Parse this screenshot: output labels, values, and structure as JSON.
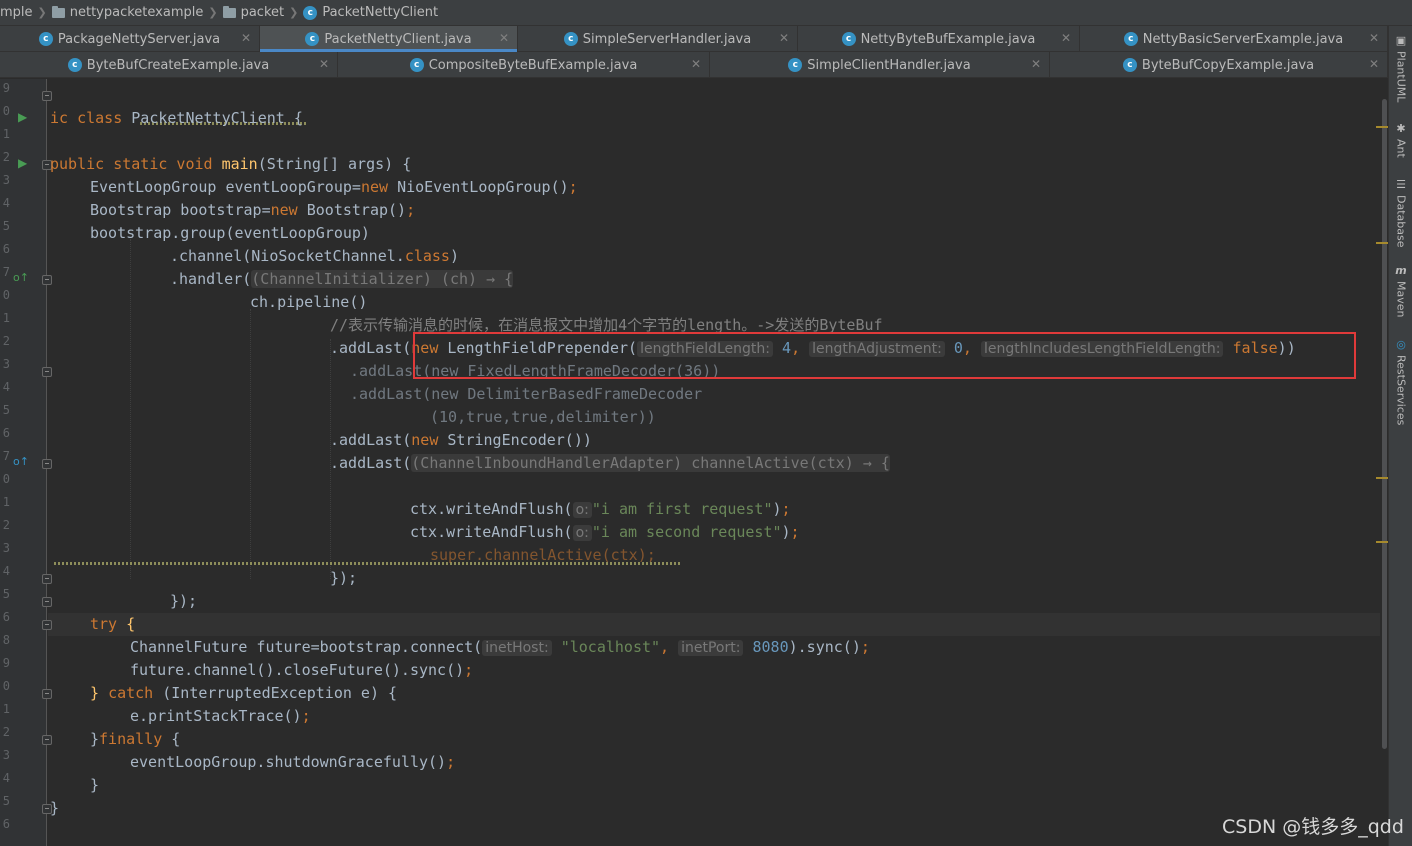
{
  "breadcrumb": {
    "items": [
      "mple",
      "nettypacketexample",
      "packet",
      "PacketNettyClient"
    ]
  },
  "tabs_row1": [
    {
      "label": "PackageNettyServer.java",
      "active": false
    },
    {
      "label": "PacketNettyClient.java",
      "active": true
    },
    {
      "label": "SimpleServerHandler.java",
      "active": false
    },
    {
      "label": "NettyByteBufExample.java",
      "active": false
    },
    {
      "label": "NettyBasicServerExample.java",
      "active": false
    }
  ],
  "tabs_row2": [
    {
      "label": "ByteBufCreateExample.java"
    },
    {
      "label": "CompositeByteBufExample.java"
    },
    {
      "label": "SimpleClientHandler.java"
    },
    {
      "label": "ByteBufCopyExample.java"
    }
  ],
  "gutter_numbers": [
    "9",
    "0",
    "1",
    "2",
    "3",
    "4",
    "5",
    "6",
    "7",
    "0",
    "1",
    "2",
    "3",
    "4",
    "5",
    "6",
    "7",
    "0",
    "1",
    "2",
    "3",
    "4",
    "5",
    "6",
    "8",
    "9",
    "0",
    "1",
    "2",
    "3",
    "4",
    "5",
    "6"
  ],
  "code": {
    "l1a": "ic ",
    "l1b": "class ",
    "l1c": "PacketNettyClient ",
    "l1d": "{",
    "l3a": "public static void ",
    "l3b": "main",
    "l3c": "(String[] args) {",
    "l4a": "EventLoopGroup eventLoopGroup=",
    "l4b": "new ",
    "l4c": "NioEventLoopGroup()",
    "l4d": ";",
    "l5a": "Bootstrap bootstrap=",
    "l5b": "new ",
    "l5c": "Bootstrap()",
    "l5d": ";",
    "l6": "bootstrap.group(eventLoopGroup)",
    "l7a": ".channel(NioSocketChannel.",
    "l7b": "class",
    ")": ")",
    "l8a": ".handler(",
    "l8b": "(ChannelInitializer) (ch) → {",
    "l9": "ch.pipeline()",
    "l10": "//表示传输消息的时候，在消息报文中增加4个字节的length。->发送的ByteBuf",
    "l11a": ".addLast(",
    "l11b": "new ",
    "l11c": "LengthFieldPrepender(",
    "hint_lfl": "lengthFieldLength:",
    "v_lfl": "4",
    "hint_la": "lengthAdjustment:",
    "v_la": "0",
    "hint_lil": "lengthIncludesLengthFieldLength:",
    "v_lil": "false",
    "l11end": "))",
    "l12": ".addLast(new FixedLengthFrameDecoder(36))",
    "l13": ".addLast(new DelimiterBasedFrameDecoder",
    "l14": "(10,true,true,delimiter))",
    "l15a": ".addLast(",
    "l15b": "new ",
    "l15c": "StringEncoder())",
    "l16a": ".addLast(",
    "l16b": "(ChannelInboundHandlerAdapter) channelActive(ctx) → {",
    "l18a": "ctx.writeAndFlush(",
    "hint_o": "o:",
    "l18b": "\"i am first request\"",
    "l18c": ")",
    ";": ";",
    "l19b": "\"i am second request\"",
    "l20": "super.channelActive(ctx);",
    "l21": "});",
    "l22": "});",
    "l23a": "try ",
    "l23b": "{",
    "l24a": "ChannelFuture future=bootstrap.connect(",
    "hint_host": "inetHost:",
    "v_host": "\"localhost\"",
    "comma": ", ",
    "hint_port": "inetPort:",
    "v_port": "8080",
    "l24b": ").sync()",
    "l25a": "future.channel().closeFuture().sync()",
    "l26a": "} ",
    "l26b": "catch ",
    "l26c": "(InterruptedException e) {",
    "l27": "e.printStackTrace()",
    "l28a": "}",
    "l28b": "finally ",
    "l28c": "{",
    "l29": "eventLoopGroup.shutdownGracefully()",
    "l30": "}",
    "l31": "}"
  },
  "right_panels": [
    "PlantUML",
    "Ant",
    "Database",
    "Maven",
    "RestServices"
  ],
  "watermark": "CSDN @钱多多_qdd"
}
